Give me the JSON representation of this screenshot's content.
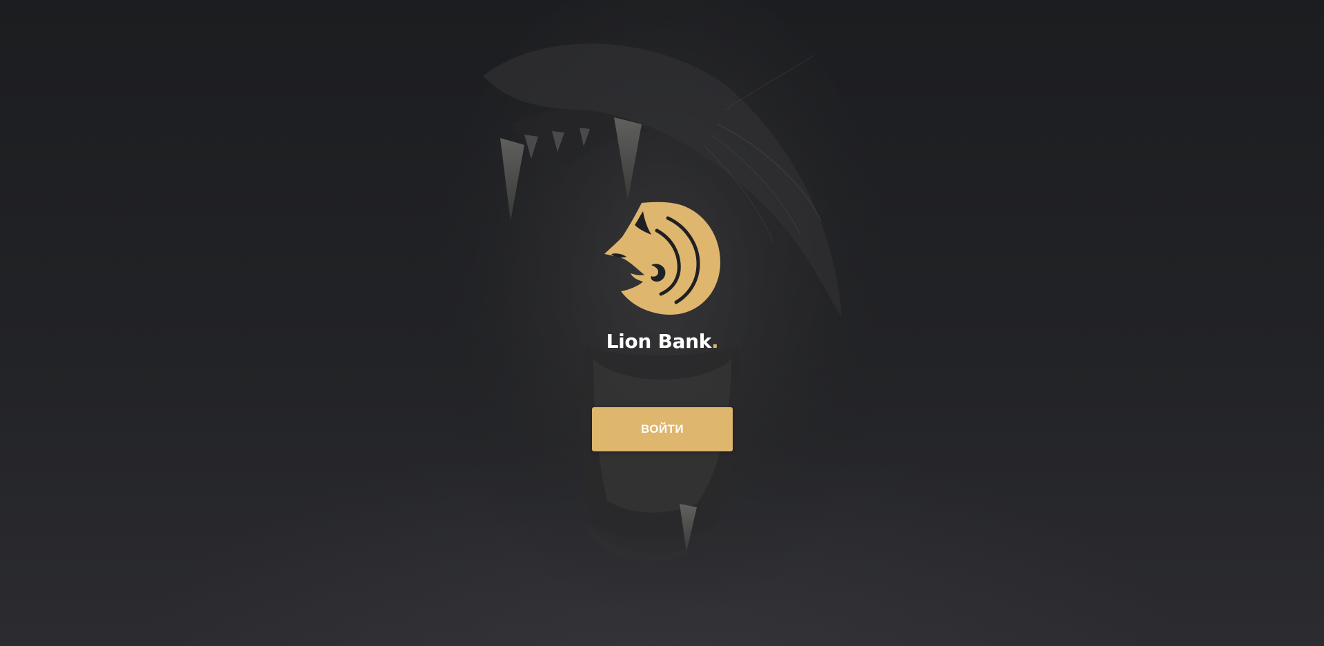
{
  "brand": {
    "name": "Lion Bank",
    "dot": ".",
    "logo_icon": "lion-head-icon",
    "accent_color": "#deb66e"
  },
  "login": {
    "button_label": "ВОЙТИ"
  },
  "background": {
    "image": "roaring-lion-photo",
    "base_color": "#1f2023"
  }
}
